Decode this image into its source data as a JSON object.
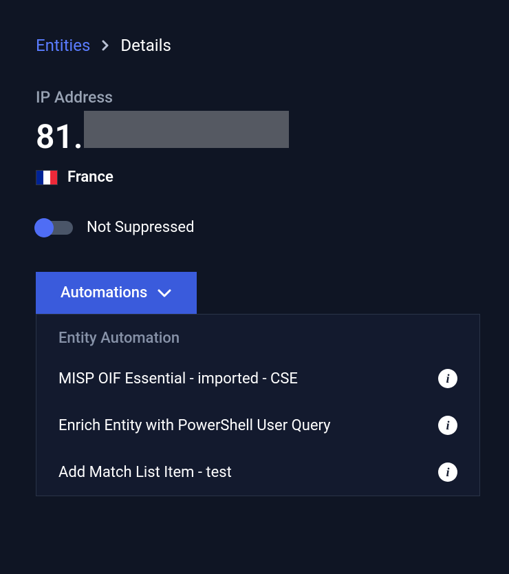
{
  "breadcrumb": {
    "link": "Entities",
    "current": "Details"
  },
  "section": {
    "label": "IP Address",
    "ip_prefix": "81."
  },
  "country": {
    "name": "France",
    "flag_colors": [
      "#002395",
      "#ffffff",
      "#ed2939"
    ]
  },
  "suppression": {
    "label": "Not Suppressed",
    "enabled": false
  },
  "automations": {
    "button_label": "Automations",
    "dropdown_header": "Entity Automation",
    "items": [
      {
        "label": "MISP OIF Essential - imported - CSE"
      },
      {
        "label": "Enrich Entity with PowerShell User Query"
      },
      {
        "label": "Add Match List Item - test"
      }
    ]
  }
}
